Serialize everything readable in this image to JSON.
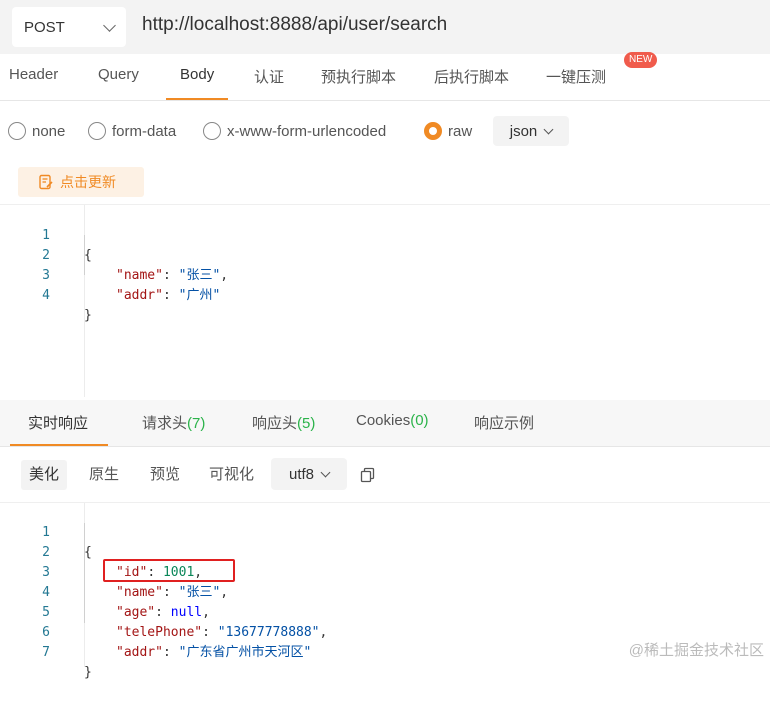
{
  "request": {
    "method": "POST",
    "url": "http://localhost:8888/api/user/search"
  },
  "tabs": [
    {
      "label": "Header"
    },
    {
      "label": "Query"
    },
    {
      "label": "Body",
      "active": true
    },
    {
      "label": "认证"
    },
    {
      "label": "预执行脚本"
    },
    {
      "label": "后执行脚本"
    },
    {
      "label": "一键压测"
    }
  ],
  "new_badge": "NEW",
  "body_types": [
    {
      "label": "none"
    },
    {
      "label": "form-data"
    },
    {
      "label": "x-www-form-urlencoded"
    },
    {
      "label": "raw",
      "checked": true
    }
  ],
  "raw_format": "json",
  "update_button": "点击更新",
  "request_body": {
    "line_numbers": [
      "1",
      "2",
      "3",
      "4"
    ],
    "lines": {
      "l1": "{",
      "l2_key": "\"name\"",
      "l2_val": "\"张三\"",
      "l3_key": "\"addr\"",
      "l3_val": "\"广州\"",
      "l4": "}"
    }
  },
  "response_tabs": {
    "realtime": "实时响应",
    "req_headers": "请求头",
    "req_headers_count": "(7)",
    "res_headers": "响应头",
    "res_headers_count": "(5)",
    "cookies": "Cookies",
    "cookies_count": "(0)",
    "example": "响应示例"
  },
  "view_modes": {
    "pretty": "美化",
    "raw": "原生",
    "preview": "预览",
    "visualize": "可视化"
  },
  "encoding": "utf8",
  "response_body": {
    "line_numbers": [
      "1",
      "2",
      "3",
      "4",
      "5",
      "6",
      "7"
    ],
    "lines": {
      "l1": "{",
      "id_key": "\"id\"",
      "id_val": "1001",
      "name_key": "\"name\"",
      "name_val": "\"张三\"",
      "age_key": "\"age\"",
      "age_val": "null",
      "tel_key": "\"telePhone\"",
      "tel_val": "\"13677778888\"",
      "addr_key": "\"addr\"",
      "addr_val": "\"广东省广州市天河区\"",
      "l7": "}"
    }
  },
  "watermark": "@稀土掘金技术社区",
  "colors": {
    "accent": "#f08a24",
    "highlight_border": "#e02020",
    "count_green": "#2bb34a"
  }
}
